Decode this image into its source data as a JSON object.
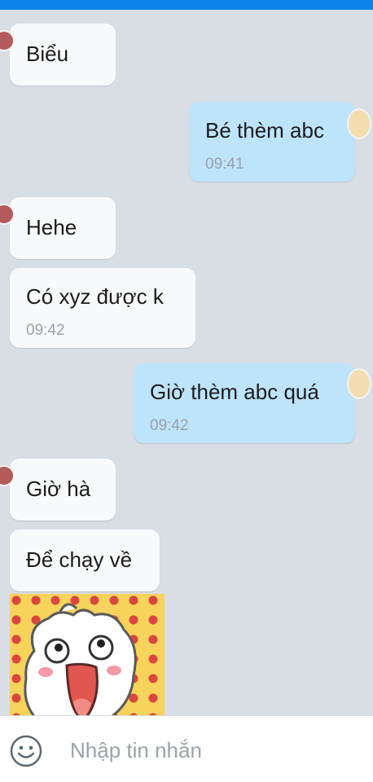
{
  "messages": [
    {
      "side": "in",
      "text": "Biểu"
    },
    {
      "side": "out",
      "text": "Bé thèm abc",
      "time": "09:41"
    },
    {
      "side": "in",
      "text": "Hehe"
    },
    {
      "side": "in",
      "text": "Có xyz được k",
      "time": "09:42"
    },
    {
      "side": "out",
      "text": "Giờ thèm abc quá",
      "time": "09:42"
    },
    {
      "side": "in",
      "text": "Giờ hà"
    },
    {
      "side": "in",
      "text": "Để chạy về"
    }
  ],
  "sticker": {
    "name": "laughing-cartoon-face"
  },
  "composer": {
    "placeholder": "Nhập tin nhắn",
    "value": "",
    "emoji_icon": "smiley-face-icon"
  },
  "colors": {
    "status_bar": "#0a84e8",
    "chat_background": "#d9dde4",
    "incoming_bubble": "#f8f9fb",
    "outgoing_bubble": "#bde4fb",
    "timestamp": "#9aa2ab"
  }
}
